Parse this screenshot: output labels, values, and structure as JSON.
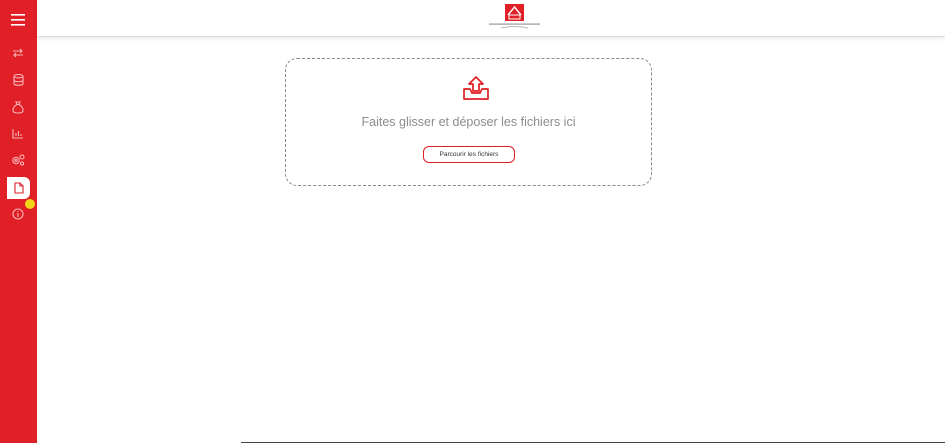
{
  "colors": {
    "accent": "#e01f26",
    "badge": "#f2d516",
    "muted_text": "#8c8c8c"
  },
  "sidebar": {
    "items": [
      {
        "icon": "menu-icon"
      },
      {
        "icon": "transfer-arrows-icon"
      },
      {
        "icon": "database-icon"
      },
      {
        "icon": "money-bag-icon"
      },
      {
        "icon": "bar-chart-icon"
      },
      {
        "icon": "settings-gears-icon"
      },
      {
        "icon": "document-icon",
        "active": true
      },
      {
        "icon": "info-icon"
      }
    ]
  },
  "header": {
    "logo": "company-logo",
    "user_menu_icon": "chevron-down-icon"
  },
  "dropzone": {
    "message": "Faites glisser et déposer les fichiers ici",
    "browse_label": "Parcourir les fichiers",
    "icon": "upload-tray-icon"
  }
}
